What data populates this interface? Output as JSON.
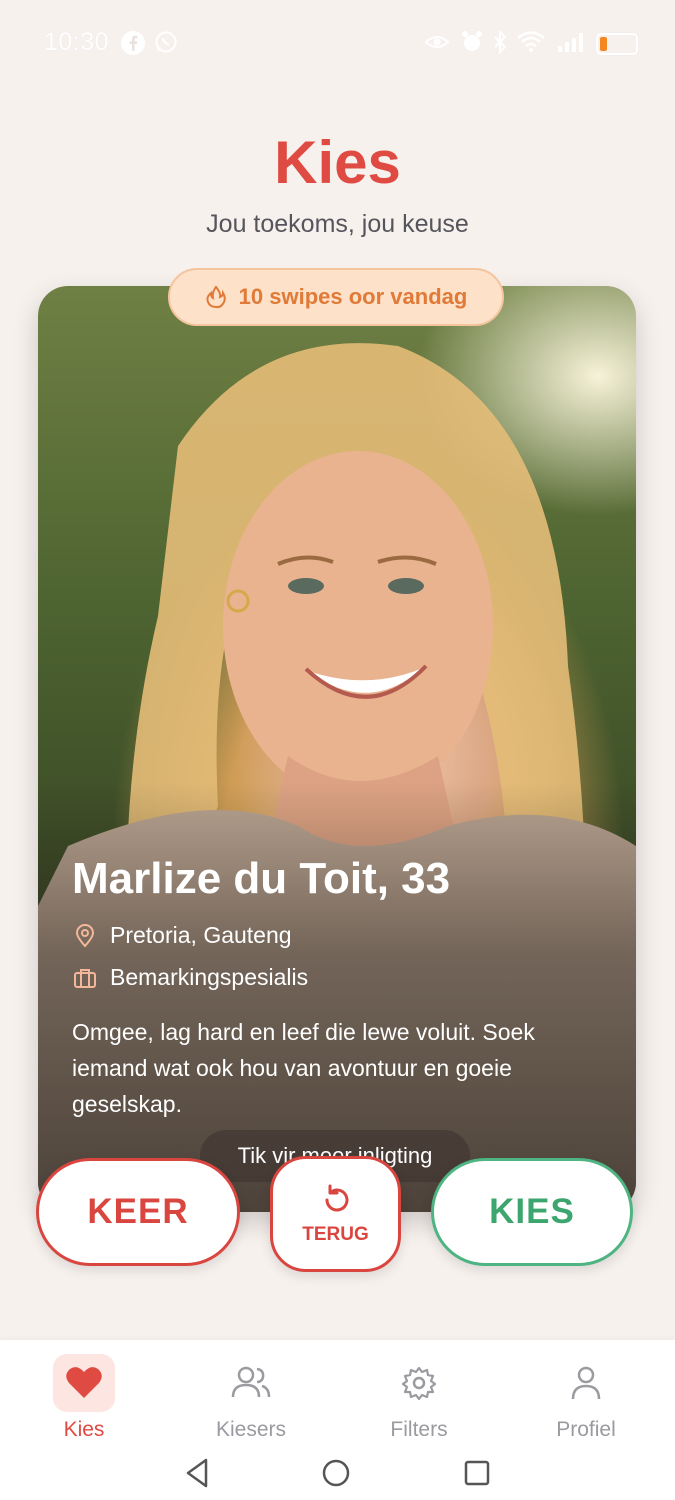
{
  "status_bar": {
    "time": "10:30",
    "battery_level": 0.2
  },
  "header": {
    "title": "Kies",
    "subtitle": "Jou toekoms, jou keuse"
  },
  "swipes_badge": {
    "icon": "flame-icon",
    "text": "10 swipes oor vandag"
  },
  "profile": {
    "name_age": "Marlize du Toit, 33",
    "location": "Pretoria, Gauteng",
    "occupation": "Bemarkingspesialis",
    "bio": "Omgee, lag hard en leef die lewe voluit. Soek iemand wat ook hou van avontuur en goeie geselskap.",
    "more_info": "Tik vir meer inligting"
  },
  "actions": {
    "reject": "KEER",
    "undo": "TERUG",
    "accept": "KIES"
  },
  "nav": {
    "items": [
      {
        "label": "Kies",
        "icon": "heart-icon",
        "active": true
      },
      {
        "label": "Kiesers",
        "icon": "users-icon",
        "active": false
      },
      {
        "label": "Filters",
        "icon": "gear-icon",
        "active": false
      },
      {
        "label": "Profiel",
        "icon": "person-icon",
        "active": false
      }
    ]
  },
  "colors": {
    "accent": "#df4b43",
    "accept": "#4db482",
    "badge_bg": "#fde1c9",
    "badge_text": "#e07a38",
    "background": "#f7f1ee"
  }
}
